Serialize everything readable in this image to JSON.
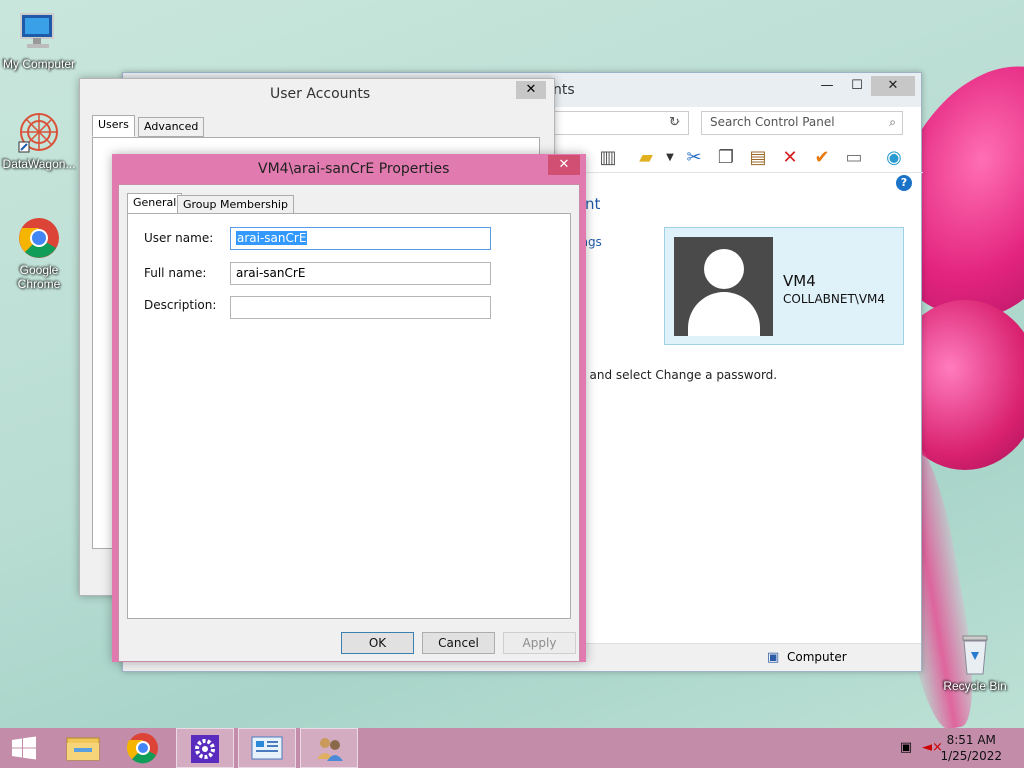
{
  "desktop": {
    "icons": [
      {
        "label": "My Computer",
        "icon": "monitor-icon"
      },
      {
        "label": "DataWagon...",
        "icon": "datawagon-icon"
      },
      {
        "label": "Google Chrome",
        "icon": "chrome-icon"
      },
      {
        "label": "Recycle Bin",
        "icon": "recycle-bin-icon"
      }
    ]
  },
  "control_panel": {
    "title_fragment": "nts",
    "search_placeholder": "Search Control Panel",
    "heading_fragment": "nt",
    "link_fragment": "ings",
    "password_text": "el and select Change a password.",
    "user_card": {
      "name": "VM4",
      "domain": "COLLABNET\\VM4"
    },
    "status_location": "Computer"
  },
  "user_accounts": {
    "title": "User Accounts",
    "tabs": [
      "Users",
      "Advanced"
    ]
  },
  "properties": {
    "title": "VM4\\arai-sanCrE Properties",
    "tabs": [
      "General",
      "Group Membership"
    ],
    "fields": {
      "user_name_label": "User name:",
      "user_name_value": "arai-sanCrE",
      "full_name_label": "Full name:",
      "full_name_value": "arai-sanCrE",
      "description_label": "Description:",
      "description_value": ""
    },
    "buttons": {
      "ok": "OK",
      "cancel": "Cancel",
      "apply": "Apply"
    }
  },
  "taskbar": {
    "time": "8:51 AM",
    "date": "1/25/2022"
  },
  "colors": {
    "dialog_frame": "#e17aae",
    "taskbar": "#c38daa",
    "selection": "#3399ff"
  }
}
